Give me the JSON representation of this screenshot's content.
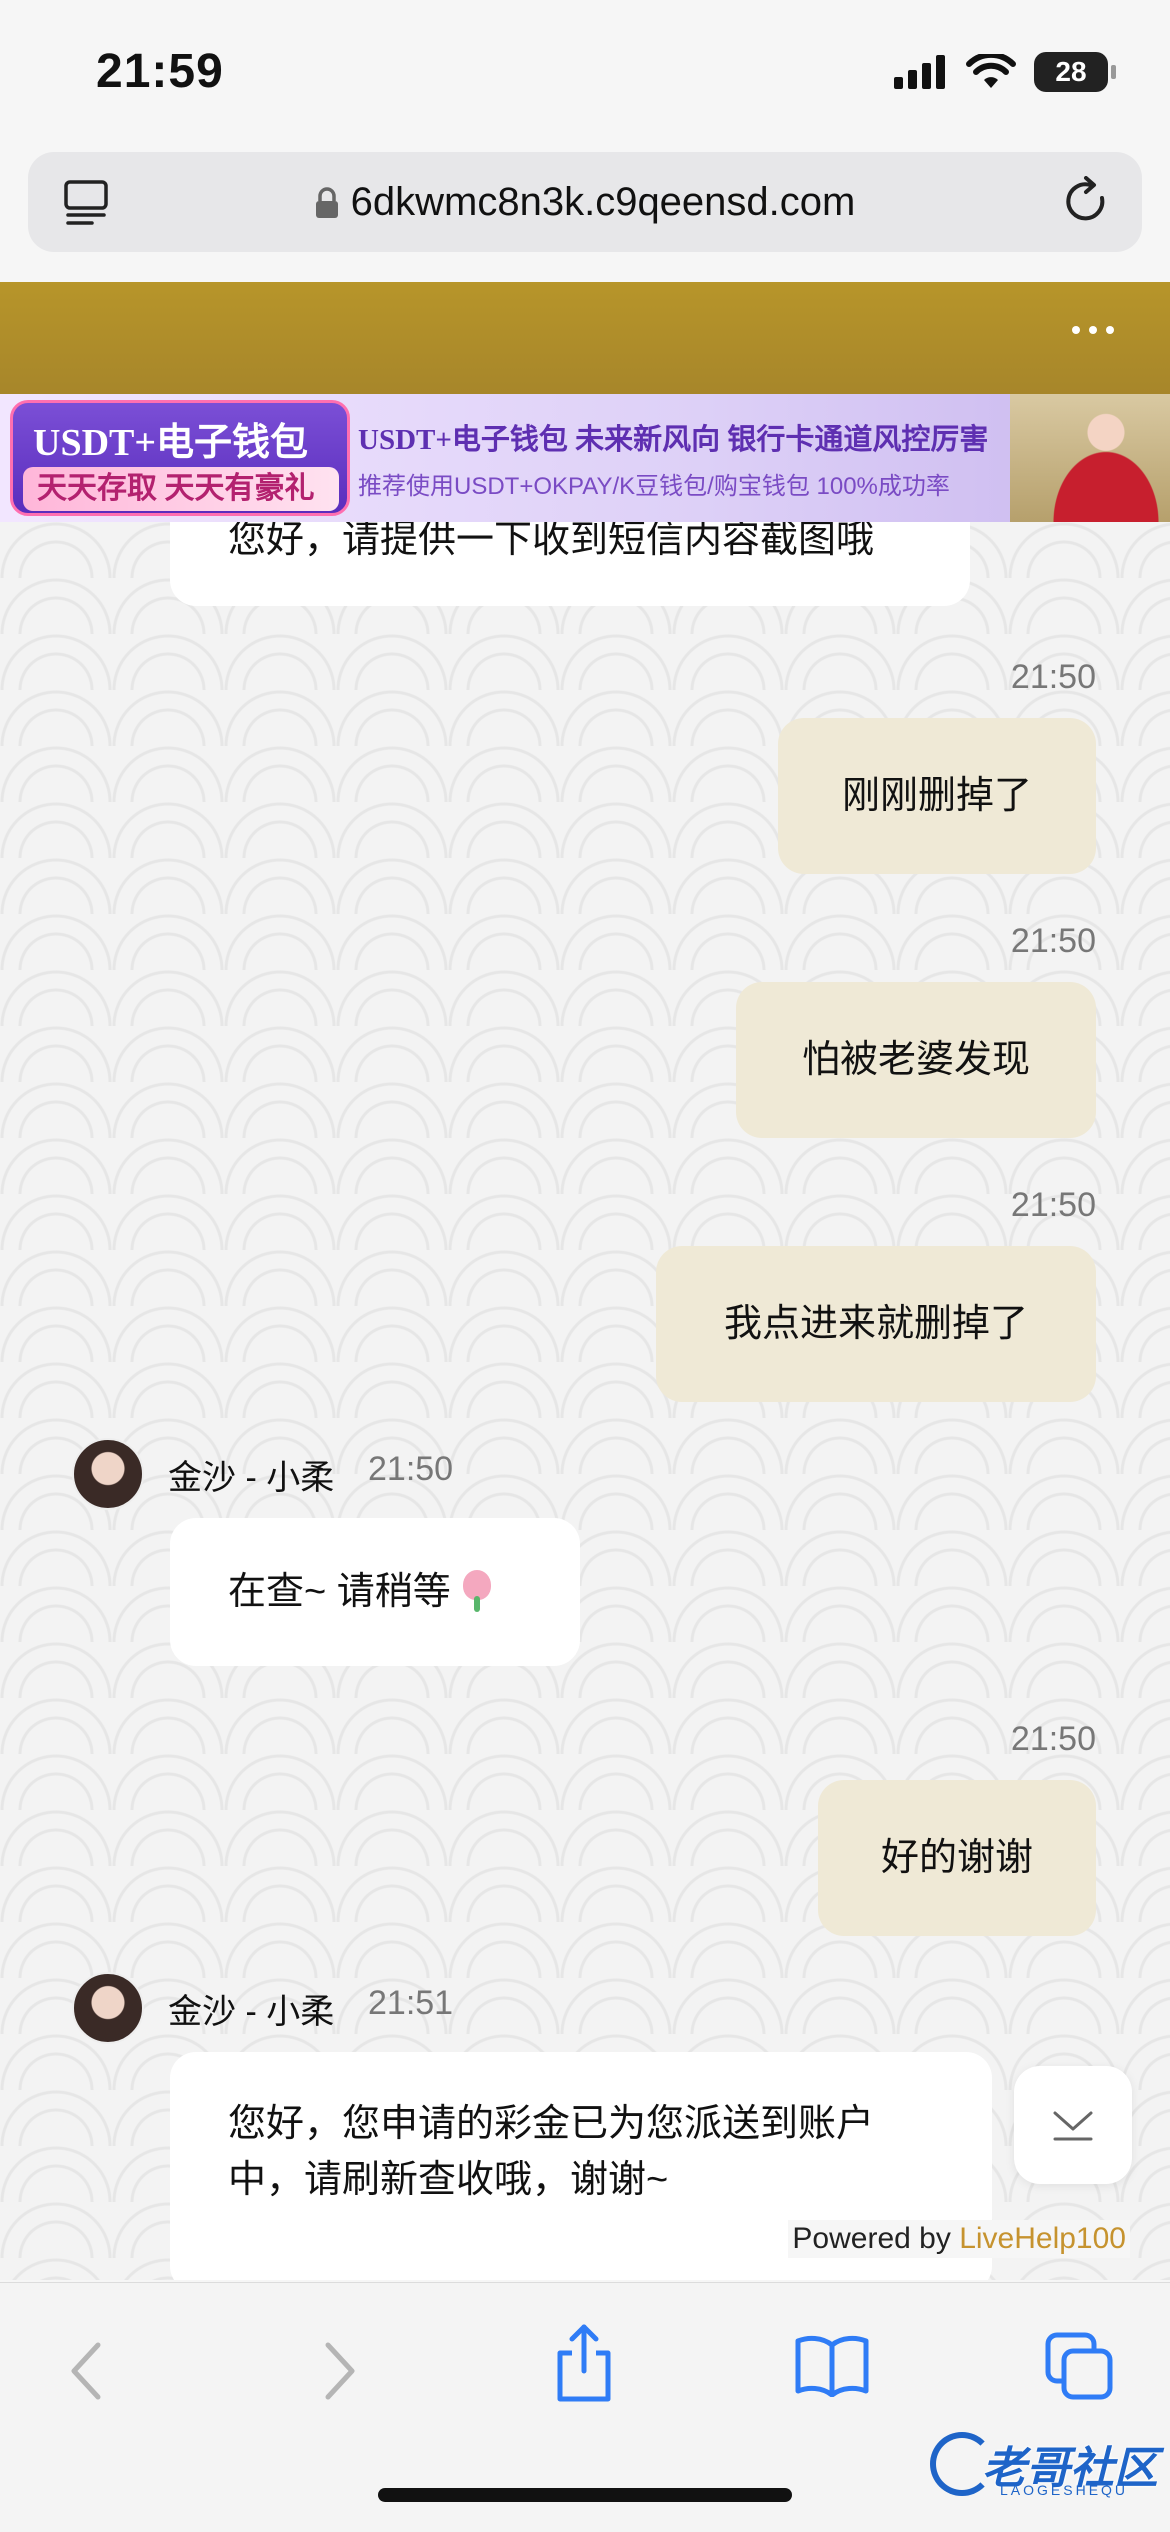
{
  "status_bar": {
    "time": "21:59",
    "battery": "28"
  },
  "browser": {
    "url": "6dkwmc8n3k.c9qeensd.com"
  },
  "banner": {
    "left_line1": "USDT+电子钱包",
    "left_line2": "天天存取 天天有豪礼",
    "main_line1": "USDT+电子钱包  未来新风向  银行卡通道风控厉害",
    "main_line2": "推荐使用USDT+OKPAY/K豆钱包/购宝钱包  100%成功率"
  },
  "chat": {
    "partial_incoming": "您好，请提供一下收到短信内容截图哦",
    "messages": [
      {
        "time": "21:50",
        "text": "刚刚删掉了"
      },
      {
        "time": "21:50",
        "text": "怕被老婆发现"
      },
      {
        "time": "21:50",
        "text": "我点进来就删掉了"
      },
      {
        "sender": "金沙 - 小柔",
        "time": "21:50",
        "text": "在查~ 请稍等"
      },
      {
        "time": "21:50",
        "text": "好的谢谢"
      },
      {
        "sender": "金沙 - 小柔",
        "time": "21:51",
        "text": "您好，您申请的彩金已为您派送到账户中，请刷新查收哦，谢谢~"
      }
    ]
  },
  "footer": {
    "powered_by": "Powered by",
    "brand": "LiveHelp100"
  },
  "watermark": {
    "title": "老哥社区",
    "subtitle": "LAOGESHEQU"
  }
}
